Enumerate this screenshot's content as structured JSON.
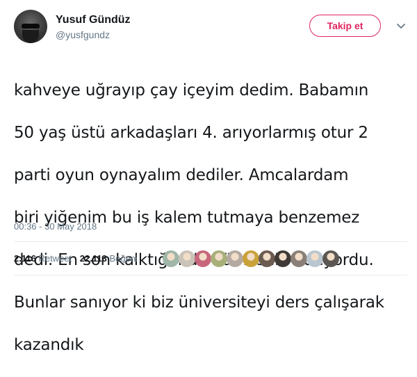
{
  "user": {
    "name": "Yusuf Gündüz",
    "handle": "@yusfgundz"
  },
  "follow_button": {
    "label": "Takip et"
  },
  "tweet": {
    "lines": [
      "kahveye uğrayıp çay içeyim dedim. Babamın",
      "50 yaş üstü arkadaşları 4. arıyorlarmış otur 2",
      "parti oyun oynayalım dediler. Amcalardam",
      "biri yiğenim bu iş kalem tutmaya benzemez",
      "dedi. En son kalktığımda 3ü hesabı ödüyordu.",
      "Bunlar sanıyor ki biz üniversiteyi ders çalışarak",
      "kazandık"
    ],
    "timestamp": "00:36 - 30 May 2018"
  },
  "stats": {
    "retweet_count": "2.116",
    "retweet_label": "Retweet",
    "like_count": "22.113",
    "like_label": "Beğeni"
  },
  "liker_avatars": [
    {
      "name": "liker-avatar-1",
      "color": "#9fb6a8"
    },
    {
      "name": "liker-avatar-2",
      "color": "#c9c3b8"
    },
    {
      "name": "liker-avatar-3",
      "color": "#c7667b"
    },
    {
      "name": "liker-avatar-4",
      "color": "#a8b07a"
    },
    {
      "name": "liker-avatar-5",
      "color": "#b4aaa2"
    },
    {
      "name": "liker-avatar-6",
      "color": "#c9a23a"
    },
    {
      "name": "liker-avatar-7",
      "color": "#6b5b50"
    },
    {
      "name": "liker-avatar-8",
      "color": "#3f3a36"
    },
    {
      "name": "liker-avatar-9",
      "color": "#8a8077"
    },
    {
      "name": "liker-avatar-10",
      "color": "#b9c6d0"
    },
    {
      "name": "liker-avatar-11",
      "color": "#5c5752"
    }
  ],
  "colors": {
    "accent": "#e0245e",
    "secondary_text": "#657786",
    "primary_text": "#14171a",
    "divider": "#e6ecf0"
  }
}
